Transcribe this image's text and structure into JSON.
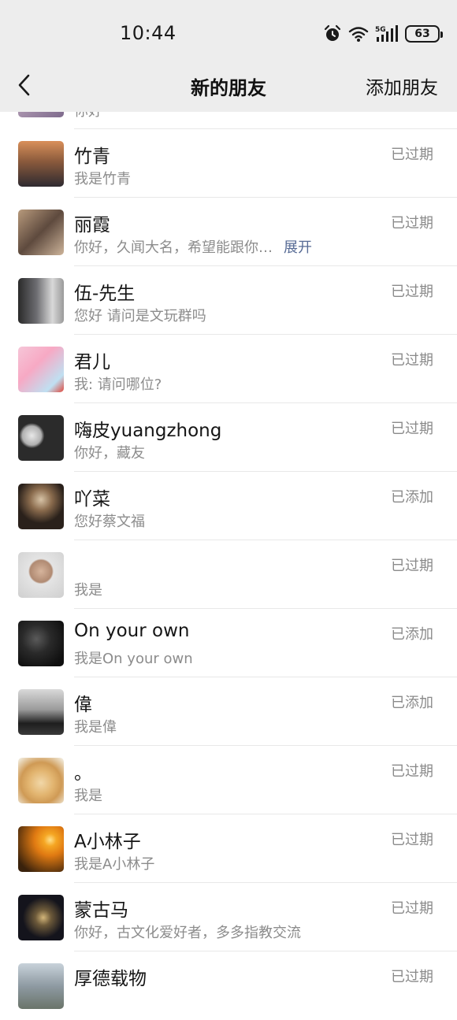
{
  "status_bar": {
    "time": "10:44",
    "battery": "63"
  },
  "nav": {
    "title": "新的朋友",
    "action": "添加朋友"
  },
  "colors": {
    "nav_bg": "#ededed",
    "link": "#576b95",
    "muted": "#8c8c8c"
  },
  "partial_top": {
    "msg": "你好"
  },
  "contacts": [
    {
      "name": "竹青",
      "msg": "我是竹青",
      "status": "已过期"
    },
    {
      "name": "丽霞",
      "msg": "你好，久闻大名，希望能跟你…",
      "expand": "展开",
      "status": "已过期"
    },
    {
      "name": "伍-先生",
      "msg": "您好 请问是文玩群吗",
      "status": "已过期"
    },
    {
      "name": "君儿",
      "msg": "我: 请问哪位?",
      "status": "已过期"
    },
    {
      "name": "嗨皮yuangzhong",
      "msg": "你好，藏友",
      "status": "已过期"
    },
    {
      "name": "吖菜",
      "msg": "您好蔡文福",
      "status": "已添加"
    },
    {
      "name": "",
      "msg": "我是",
      "status": "已过期"
    },
    {
      "name": "On your own",
      "msg": "我是On your own",
      "status": "已添加"
    },
    {
      "name": "偉",
      "msg": "我是偉",
      "status": "已添加"
    },
    {
      "name": "。",
      "msg": "我是",
      "status": "已过期"
    },
    {
      "name": "A小林子",
      "msg": "我是A小林子",
      "status": "已过期"
    },
    {
      "name": "蒙古马",
      "msg": "你好，古文化爱好者，多多指教交流",
      "status": "已过期"
    },
    {
      "name": "厚德载物",
      "msg": "",
      "status": "已过期"
    }
  ]
}
